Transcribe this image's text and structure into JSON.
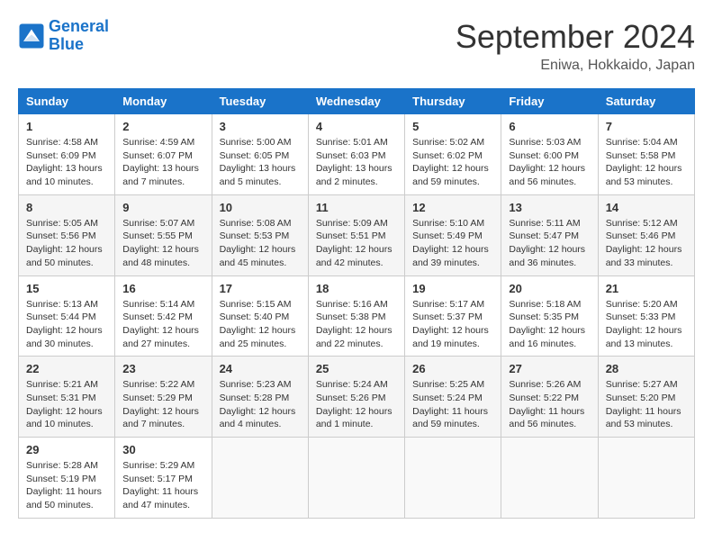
{
  "header": {
    "logo_line1": "General",
    "logo_line2": "Blue",
    "month": "September 2024",
    "location": "Eniwa, Hokkaido, Japan"
  },
  "weekdays": [
    "Sunday",
    "Monday",
    "Tuesday",
    "Wednesday",
    "Thursday",
    "Friday",
    "Saturday"
  ],
  "weeks": [
    [
      {
        "day": "1",
        "info": "Sunrise: 4:58 AM\nSunset: 6:09 PM\nDaylight: 13 hours and 10 minutes."
      },
      {
        "day": "2",
        "info": "Sunrise: 4:59 AM\nSunset: 6:07 PM\nDaylight: 13 hours and 7 minutes."
      },
      {
        "day": "3",
        "info": "Sunrise: 5:00 AM\nSunset: 6:05 PM\nDaylight: 13 hours and 5 minutes."
      },
      {
        "day": "4",
        "info": "Sunrise: 5:01 AM\nSunset: 6:03 PM\nDaylight: 13 hours and 2 minutes."
      },
      {
        "day": "5",
        "info": "Sunrise: 5:02 AM\nSunset: 6:02 PM\nDaylight: 12 hours and 59 minutes."
      },
      {
        "day": "6",
        "info": "Sunrise: 5:03 AM\nSunset: 6:00 PM\nDaylight: 12 hours and 56 minutes."
      },
      {
        "day": "7",
        "info": "Sunrise: 5:04 AM\nSunset: 5:58 PM\nDaylight: 12 hours and 53 minutes."
      }
    ],
    [
      {
        "day": "8",
        "info": "Sunrise: 5:05 AM\nSunset: 5:56 PM\nDaylight: 12 hours and 50 minutes."
      },
      {
        "day": "9",
        "info": "Sunrise: 5:07 AM\nSunset: 5:55 PM\nDaylight: 12 hours and 48 minutes."
      },
      {
        "day": "10",
        "info": "Sunrise: 5:08 AM\nSunset: 5:53 PM\nDaylight: 12 hours and 45 minutes."
      },
      {
        "day": "11",
        "info": "Sunrise: 5:09 AM\nSunset: 5:51 PM\nDaylight: 12 hours and 42 minutes."
      },
      {
        "day": "12",
        "info": "Sunrise: 5:10 AM\nSunset: 5:49 PM\nDaylight: 12 hours and 39 minutes."
      },
      {
        "day": "13",
        "info": "Sunrise: 5:11 AM\nSunset: 5:47 PM\nDaylight: 12 hours and 36 minutes."
      },
      {
        "day": "14",
        "info": "Sunrise: 5:12 AM\nSunset: 5:46 PM\nDaylight: 12 hours and 33 minutes."
      }
    ],
    [
      {
        "day": "15",
        "info": "Sunrise: 5:13 AM\nSunset: 5:44 PM\nDaylight: 12 hours and 30 minutes."
      },
      {
        "day": "16",
        "info": "Sunrise: 5:14 AM\nSunset: 5:42 PM\nDaylight: 12 hours and 27 minutes."
      },
      {
        "day": "17",
        "info": "Sunrise: 5:15 AM\nSunset: 5:40 PM\nDaylight: 12 hours and 25 minutes."
      },
      {
        "day": "18",
        "info": "Sunrise: 5:16 AM\nSunset: 5:38 PM\nDaylight: 12 hours and 22 minutes."
      },
      {
        "day": "19",
        "info": "Sunrise: 5:17 AM\nSunset: 5:37 PM\nDaylight: 12 hours and 19 minutes."
      },
      {
        "day": "20",
        "info": "Sunrise: 5:18 AM\nSunset: 5:35 PM\nDaylight: 12 hours and 16 minutes."
      },
      {
        "day": "21",
        "info": "Sunrise: 5:20 AM\nSunset: 5:33 PM\nDaylight: 12 hours and 13 minutes."
      }
    ],
    [
      {
        "day": "22",
        "info": "Sunrise: 5:21 AM\nSunset: 5:31 PM\nDaylight: 12 hours and 10 minutes."
      },
      {
        "day": "23",
        "info": "Sunrise: 5:22 AM\nSunset: 5:29 PM\nDaylight: 12 hours and 7 minutes."
      },
      {
        "day": "24",
        "info": "Sunrise: 5:23 AM\nSunset: 5:28 PM\nDaylight: 12 hours and 4 minutes."
      },
      {
        "day": "25",
        "info": "Sunrise: 5:24 AM\nSunset: 5:26 PM\nDaylight: 12 hours and 1 minute."
      },
      {
        "day": "26",
        "info": "Sunrise: 5:25 AM\nSunset: 5:24 PM\nDaylight: 11 hours and 59 minutes."
      },
      {
        "day": "27",
        "info": "Sunrise: 5:26 AM\nSunset: 5:22 PM\nDaylight: 11 hours and 56 minutes."
      },
      {
        "day": "28",
        "info": "Sunrise: 5:27 AM\nSunset: 5:20 PM\nDaylight: 11 hours and 53 minutes."
      }
    ],
    [
      {
        "day": "29",
        "info": "Sunrise: 5:28 AM\nSunset: 5:19 PM\nDaylight: 11 hours and 50 minutes."
      },
      {
        "day": "30",
        "info": "Sunrise: 5:29 AM\nSunset: 5:17 PM\nDaylight: 11 hours and 47 minutes."
      },
      {
        "day": "",
        "info": ""
      },
      {
        "day": "",
        "info": ""
      },
      {
        "day": "",
        "info": ""
      },
      {
        "day": "",
        "info": ""
      },
      {
        "day": "",
        "info": ""
      }
    ]
  ]
}
